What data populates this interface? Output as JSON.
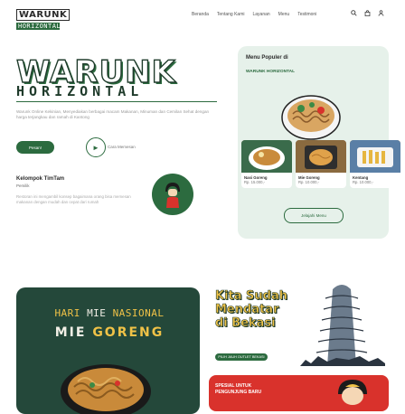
{
  "header": {
    "logo_line1": "WARUNK",
    "logo_line2": "HORIZONTAL",
    "nav": [
      "Beranda",
      "Tentang Kami",
      "Layanan",
      "Menu",
      "Testimoni"
    ]
  },
  "hero": {
    "title": "WARUNK",
    "subtitle": "HORIZONTAL",
    "description": "Warunk Online Kekinian, Menyediakan berbagai macam Makanan, Minuman dan Cemilan Sehat dengan harga terjangkau dan ramah di Kantong",
    "primary_button": "Pesan!",
    "secondary_label": "Cara Memesan"
  },
  "team": {
    "title": "Kelompok TimTam",
    "subtitle": "Pemilik",
    "description": "Restoran ini mengambil konsep bagaimana orang bisa memesan makanan dengan mudah dan cepat dari rumah"
  },
  "menu": {
    "title_line1": "Menu Populer di",
    "title_line2": "WARUNK HORIZONTAL",
    "items": [
      {
        "name": "Nasi Goreng",
        "price": "Rp. 15.000,-"
      },
      {
        "name": "Mie Goreng",
        "price": "Rp. 10.000,-"
      },
      {
        "name": "Kentang",
        "price": "Rp. 10.000,-"
      }
    ],
    "button": "Jelajahi Menu"
  },
  "promo": {
    "line1_a": "HARI",
    "line1_b": "MIE",
    "line1_c": "NASIONAL",
    "line2_a": "MIE",
    "line2_b": "GORENG"
  },
  "location": {
    "line1": "Kita Sudah",
    "line2": "Mendatar",
    "line3": "di Bekasi",
    "button": "PILIH JAUH OUTLET BEKASI"
  },
  "special": {
    "line1": "SPESIAL UNTUK",
    "line2": "PENGUNJUNG BARU"
  },
  "colors": {
    "brand_green": "#2c6b3f",
    "dark_green": "#24483a",
    "accent_yellow": "#f0c247",
    "accent_red": "#d9322c",
    "card_mint": "#e6f1ea"
  }
}
